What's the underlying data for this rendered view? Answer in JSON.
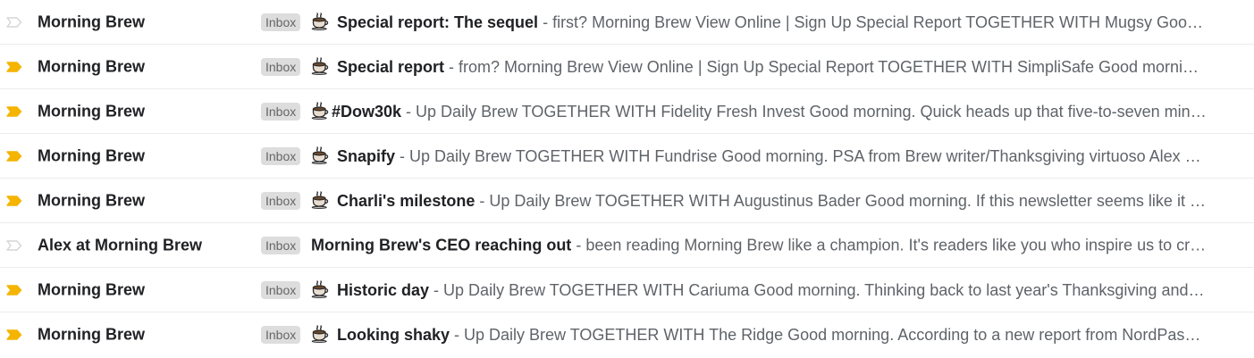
{
  "colors": {
    "important_marker": "#f4b400",
    "unimportant_marker": "#d5d5d5",
    "label_bg": "#dddddd",
    "label_text": "#666666",
    "sender_text": "#202124",
    "snippet_text": "#5f6368"
  },
  "emails": [
    {
      "important": false,
      "marker_icon": "importance-marker-outline-icon",
      "sender": "Morning Brew",
      "label": "Inbox",
      "has_coffee_icon": true,
      "subject": "Special report: The sequel",
      "separator": " - ",
      "snippet": "first? Morning Brew View Online | Sign Up Special Report TOGETHER WITH Mugsy Good morning. Is this the first time you've been"
    },
    {
      "important": true,
      "marker_icon": "importance-marker-filled-icon",
      "sender": "Morning Brew",
      "label": "Inbox",
      "has_coffee_icon": true,
      "subject": "Special report",
      "separator": " - ",
      "snippet": "from? Morning Brew View Online | Sign Up Special Report TOGETHER WITH SimpliSafe Good morning and welcome"
    },
    {
      "important": true,
      "marker_icon": "importance-marker-filled-icon",
      "sender": "Morning Brew",
      "label": "Inbox",
      "has_coffee_icon": true,
      "subject": "#Dow30k",
      "separator": " - ",
      "snippet": "Up Daily Brew TOGETHER WITH Fidelity Fresh Invest Good morning. Quick heads up that five-to-seven minutes of reading"
    },
    {
      "important": true,
      "marker_icon": "importance-marker-filled-icon",
      "sender": "Morning Brew",
      "label": "Inbox",
      "has_coffee_icon": true,
      "subject": "Snapify",
      "separator": " - ",
      "snippet": "Up Daily Brew TOGETHER WITH Fundrise Good morning. PSA from Brew writer/Thanksgiving virtuoso Alex Hickey"
    },
    {
      "important": true,
      "marker_icon": "importance-marker-filled-icon",
      "sender": "Morning Brew",
      "label": "Inbox",
      "has_coffee_icon": true,
      "subject": "Charli's milestone",
      "separator": " - ",
      "snippet": "Up Daily Brew TOGETHER WITH Augustinus Bader Good morning. If this newsletter seems like it was written"
    },
    {
      "important": false,
      "marker_icon": "importance-marker-outline-icon",
      "sender": "Alex at Morning Brew",
      "label": "Inbox",
      "has_coffee_icon": false,
      "subject": "Morning Brew's CEO reaching out",
      "separator": " - ",
      "snippet": "been reading Morning Brew like a champion. It's readers like you who inspire us to create the best"
    },
    {
      "important": true,
      "marker_icon": "importance-marker-filled-icon",
      "sender": "Morning Brew",
      "label": "Inbox",
      "has_coffee_icon": true,
      "subject": "Historic day",
      "separator": " - ",
      "snippet": "Up Daily Brew TOGETHER WITH Cariuma Good morning. Thinking back to last year's Thanksgiving and remembering"
    },
    {
      "important": true,
      "marker_icon": "importance-marker-filled-icon",
      "sender": "Morning Brew",
      "label": "Inbox",
      "has_coffee_icon": true,
      "subject": "Looking shaky",
      "separator": " - ",
      "snippet": "Up Daily Brew TOGETHER WITH The Ridge Good morning. According to a new report from NordPass , the most"
    }
  ]
}
